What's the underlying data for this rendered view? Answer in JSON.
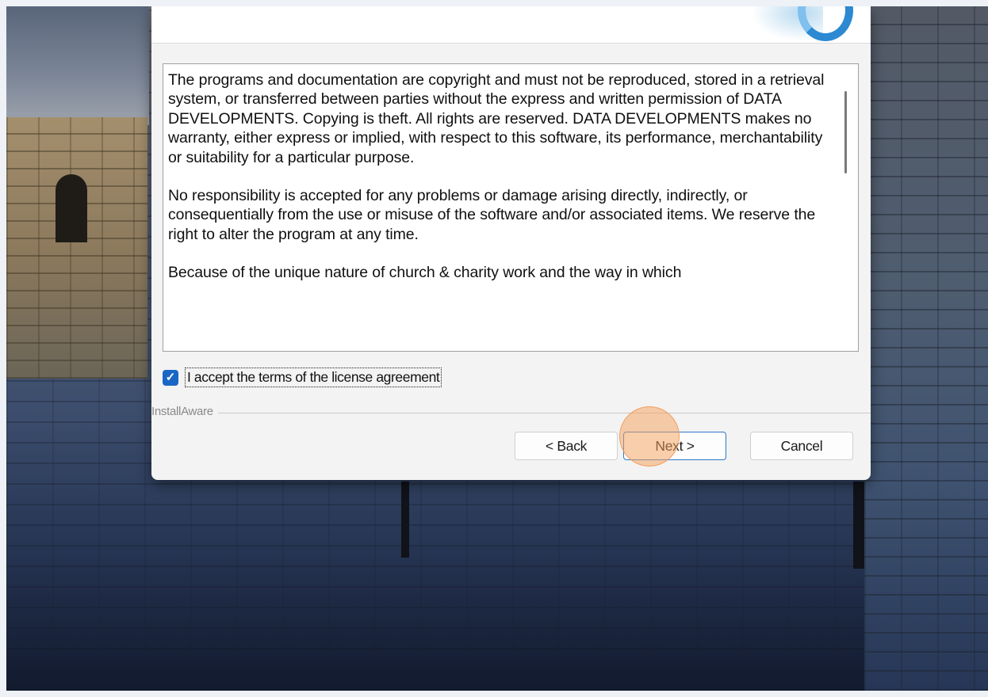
{
  "installer": {
    "license_paragraphs": [
      "The programs and documentation are copyright and must not be reproduced, stored in a retrieval system, or transferred between parties without the express and written permission of DATA DEVELOPMENTS. Copying is theft. All rights are reserved. DATA DEVELOPMENTS makes no warranty, either express or implied, with respect to this software, its performance, merchantability or suitability for a particular purpose.",
      "No responsibility is accepted for any problems or damage arising directly, indirectly, or consequentially from the use or misuse of the software and/or associated items. We reserve the right to alter the program at any time.",
      "Because of the unique nature of church & charity work and the way in which"
    ],
    "accept_checkbox": {
      "label": "I accept the terms of the license agreement",
      "checked": true
    },
    "brand_label": "InstallAware",
    "buttons": {
      "back": "< Back",
      "next": "Next >",
      "cancel": "Cancel"
    },
    "accent_color": "#1a66c5",
    "click_marker_color": "#f5a05a"
  }
}
